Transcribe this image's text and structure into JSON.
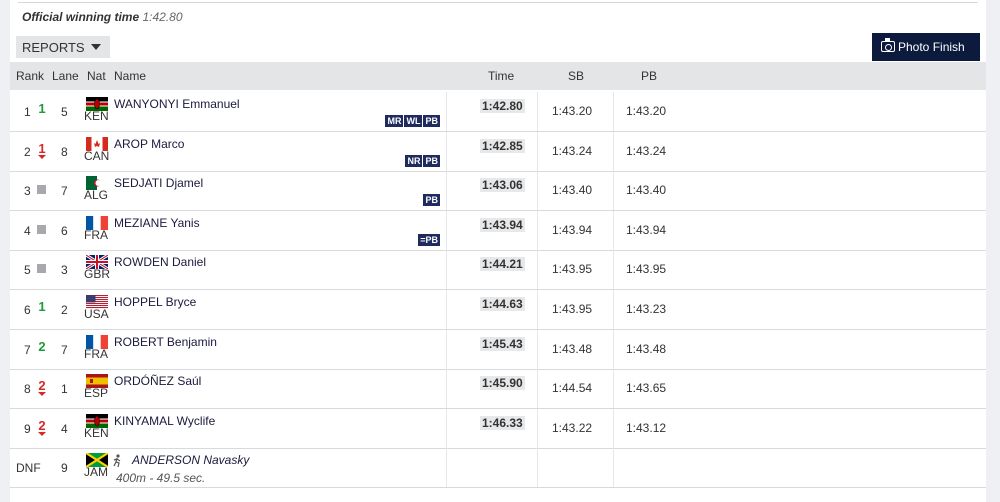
{
  "header": {
    "winning_label": "Official winning time",
    "winning_time": "1:42.80"
  },
  "toolbar": {
    "reports_label": "REPORTS",
    "photo_finish_label": "Photo Finish"
  },
  "columns": {
    "rank": "Rank",
    "lane": "Lane",
    "nat": "Nat",
    "name": "Name",
    "time": "Time",
    "sb": "SB",
    "pb": "PB"
  },
  "results": [
    {
      "rank": "1",
      "movement": "up",
      "move_count": "1",
      "lane": "5",
      "nat": "KEN",
      "name": "WANYONYI Emmanuel",
      "badges": [
        "MR",
        "WL",
        "PB"
      ],
      "time": "1:42.80",
      "sb": "1:43.20",
      "pb": "1:43.20"
    },
    {
      "rank": "2",
      "movement": "down",
      "move_count": "1",
      "lane": "8",
      "nat": "CAN",
      "name": "AROP Marco",
      "badges": [
        "NR",
        "PB"
      ],
      "time": "1:42.85",
      "sb": "1:43.24",
      "pb": "1:43.24"
    },
    {
      "rank": "3",
      "movement": "flat",
      "move_count": "",
      "lane": "7",
      "nat": "ALG",
      "name": "SEDJATI Djamel",
      "badges": [
        "PB"
      ],
      "time": "1:43.06",
      "sb": "1:43.40",
      "pb": "1:43.40"
    },
    {
      "rank": "4",
      "movement": "flat",
      "move_count": "",
      "lane": "6",
      "nat": "FRA",
      "name": "MEZIANE Yanis",
      "badges": [
        "=PB"
      ],
      "time": "1:43.94",
      "sb": "1:43.94",
      "pb": "1:43.94"
    },
    {
      "rank": "5",
      "movement": "flat",
      "move_count": "",
      "lane": "3",
      "nat": "GBR",
      "name": "ROWDEN Daniel",
      "badges": [],
      "time": "1:44.21",
      "sb": "1:43.95",
      "pb": "1:43.95"
    },
    {
      "rank": "6",
      "movement": "up",
      "move_count": "1",
      "lane": "2",
      "nat": "USA",
      "name": "HOPPEL Bryce",
      "badges": [],
      "time": "1:44.63",
      "sb": "1:43.95",
      "pb": "1:43.23"
    },
    {
      "rank": "7",
      "movement": "up",
      "move_count": "2",
      "lane": "7",
      "nat": "FRA",
      "name": "ROBERT Benjamin",
      "badges": [],
      "time": "1:45.43",
      "sb": "1:43.48",
      "pb": "1:43.48"
    },
    {
      "rank": "8",
      "movement": "down",
      "move_count": "2",
      "lane": "1",
      "nat": "ESP",
      "name": "ORDÓÑEZ Saúl",
      "badges": [],
      "time": "1:45.90",
      "sb": "1:44.54",
      "pb": "1:43.65"
    },
    {
      "rank": "9",
      "movement": "down",
      "move_count": "2",
      "lane": "4",
      "nat": "KEN",
      "name": "KINYAMAL Wyclife",
      "badges": [],
      "time": "1:46.33",
      "sb": "1:43.22",
      "pb": "1:43.12"
    },
    {
      "rank": "DNF",
      "movement": "none",
      "move_count": "",
      "lane": "9",
      "nat": "JAM",
      "name": "ANDERSON Navasky",
      "badges": [],
      "time": "",
      "sb": "",
      "pb": "",
      "note": "400m - 49.5 sec.",
      "dnf": true
    }
  ],
  "colors": {
    "header_bg": "#e4e5e7",
    "photo_btn_bg": "#0b1a3d",
    "badge_bg": "#1f2a5e",
    "up": "#1f9b3a",
    "down": "#d42a2a"
  }
}
